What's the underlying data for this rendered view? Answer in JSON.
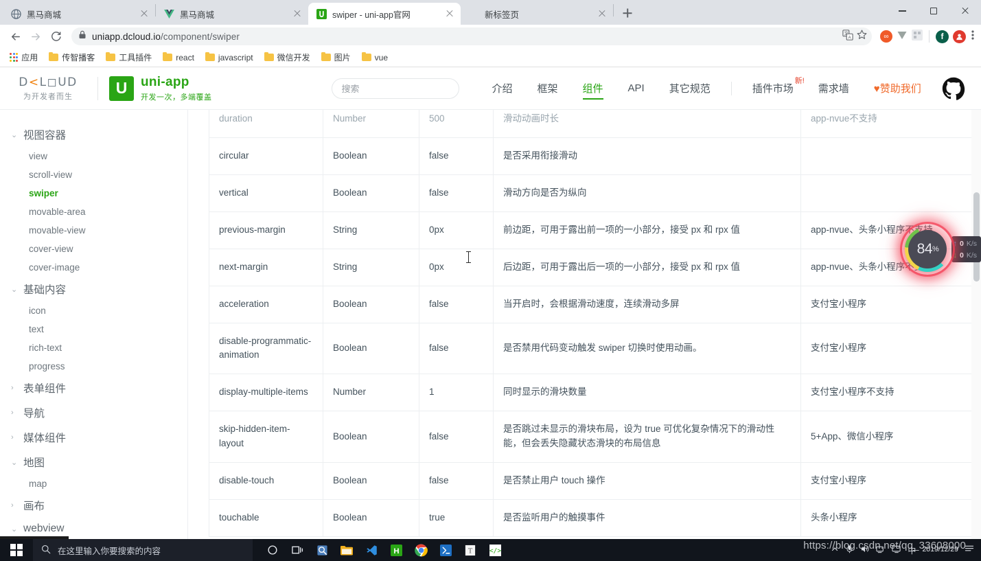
{
  "browser": {
    "tabs": [
      {
        "title": "黑马商城",
        "favicon": "globe-icon",
        "active": false
      },
      {
        "title": "黑马商城",
        "favicon": "vue-icon",
        "active": false
      },
      {
        "title": "swiper - uni-app官网",
        "favicon": "uniapp-icon",
        "active": true
      },
      {
        "title": "新标签页",
        "favicon": "none",
        "active": false
      }
    ],
    "new_tab_label": "+",
    "window_controls": {
      "minimize": "–",
      "maximize": "□",
      "close": "✕"
    },
    "address": {
      "scheme_lock": "lock-icon",
      "host": "uniapp.dcloud.io",
      "path": "/component/swiper"
    },
    "toolbar_icons": [
      "translate-icon",
      "bookmark-star-icon",
      "extension-infinity-icon",
      "extension-v-icon",
      "extension-qr-icon",
      "profile-f-icon",
      "profile-avatar-icon",
      "menu-icon"
    ],
    "bookmarks": [
      {
        "label": "应用",
        "icon": "apps-grid-icon"
      },
      {
        "label": "传智播客",
        "icon": "folder-icon"
      },
      {
        "label": "工具插件",
        "icon": "folder-icon"
      },
      {
        "label": "react",
        "icon": "folder-icon"
      },
      {
        "label": "javascript",
        "icon": "folder-icon"
      },
      {
        "label": "微信开发",
        "icon": "folder-icon"
      },
      {
        "label": "图片",
        "icon": "folder-icon"
      },
      {
        "label": "vue",
        "icon": "folder-icon"
      }
    ]
  },
  "site": {
    "dcloud": {
      "mark": "D<LOUD",
      "tagline": "为开发者而生"
    },
    "uniapp": {
      "logo_letter": "U",
      "name": "uni-app",
      "slogan": "开发一次，多端覆盖"
    },
    "search_placeholder": "搜索",
    "nav": [
      {
        "label": "介绍",
        "active": false
      },
      {
        "label": "框架",
        "active": false
      },
      {
        "label": "组件",
        "active": true
      },
      {
        "label": "API",
        "active": false
      },
      {
        "label": "其它规范",
        "active": false
      }
    ],
    "nav_right": [
      {
        "label": "插件市场",
        "badge": "新!",
        "active": false
      },
      {
        "label": "需求墙",
        "badge": "",
        "active": false
      },
      {
        "label": "赞助我们",
        "badge": "",
        "heart": "♥",
        "sponsor": true
      }
    ],
    "github_icon": "github-icon"
  },
  "sidebar": {
    "groups": [
      {
        "label": "视图容器",
        "caret": "⌄",
        "expanded": true,
        "items": [
          {
            "label": "view",
            "active": false
          },
          {
            "label": "scroll-view",
            "active": false
          },
          {
            "label": "swiper",
            "active": true
          },
          {
            "label": "movable-area",
            "active": false
          },
          {
            "label": "movable-view",
            "active": false
          },
          {
            "label": "cover-view",
            "active": false
          },
          {
            "label": "cover-image",
            "active": false
          }
        ]
      },
      {
        "label": "基础内容",
        "caret": "⌄",
        "expanded": true,
        "items": [
          {
            "label": "icon",
            "active": false
          },
          {
            "label": "text",
            "active": false
          },
          {
            "label": "rich-text",
            "active": false
          },
          {
            "label": "progress",
            "active": false
          }
        ]
      },
      {
        "label": "表单组件",
        "caret": "›",
        "expanded": false,
        "items": []
      },
      {
        "label": "导航",
        "caret": "›",
        "expanded": false,
        "items": []
      },
      {
        "label": "媒体组件",
        "caret": "›",
        "expanded": false,
        "items": []
      },
      {
        "label": "地图",
        "caret": "⌄",
        "expanded": true,
        "items": [
          {
            "label": "map",
            "active": false
          }
        ]
      },
      {
        "label": "画布",
        "caret": "›",
        "expanded": false,
        "items": []
      },
      {
        "label": "webview",
        "caret": "⌄",
        "expanded": true,
        "items": []
      }
    ]
  },
  "table": {
    "rows": [
      {
        "name": "duration",
        "type": "Number",
        "default": "500",
        "desc": "滑动动画时长",
        "platform": "app-nvue不支持",
        "clipped": true
      },
      {
        "name": "circular",
        "type": "Boolean",
        "default": "false",
        "desc": "是否采用衔接滑动",
        "platform": ""
      },
      {
        "name": "vertical",
        "type": "Boolean",
        "default": "false",
        "desc": "滑动方向是否为纵向",
        "platform": ""
      },
      {
        "name": "previous-margin",
        "type": "String",
        "default": "0px",
        "desc": "前边距，可用于露出前一项的一小部分，接受 px 和 rpx 值",
        "platform": "app-nvue、头条小程序不支持"
      },
      {
        "name": "next-margin",
        "type": "String",
        "default": "0px",
        "desc": "后边距，可用于露出后一项的一小部分，接受 px 和 rpx 值",
        "platform": "app-nvue、头条小程序不支持"
      },
      {
        "name": "acceleration",
        "type": "Boolean",
        "default": "false",
        "desc": "当开启时，会根据滑动速度，连续滑动多屏",
        "platform": "支付宝小程序"
      },
      {
        "name": "disable-programmatic-animation",
        "type": "Boolean",
        "default": "false",
        "desc": "是否禁用代码变动触发 swiper 切换时使用动画。",
        "platform": "支付宝小程序"
      },
      {
        "name": "display-multiple-items",
        "type": "Number",
        "default": "1",
        "desc": "同时显示的滑块数量",
        "platform": "支付宝小程序不支持"
      },
      {
        "name": "skip-hidden-item-layout",
        "type": "Boolean",
        "default": "false",
        "desc": "是否跳过未显示的滑块布局，设为 true 可优化复杂情况下的滑动性能，但会丢失隐藏状态滑块的布局信息",
        "platform": "5+App、微信小程序"
      },
      {
        "name": "disable-touch",
        "type": "Boolean",
        "default": "false",
        "desc": "是否禁止用户 touch 操作",
        "platform": "支付宝小程序"
      },
      {
        "name": "touchable",
        "type": "Boolean",
        "default": "true",
        "desc": "是否监听用户的触摸事件",
        "platform": "头条小程序"
      }
    ]
  },
  "netwidget": {
    "percent": "84",
    "percent_unit": "%",
    "upload": {
      "arrow": "↑",
      "value": "0",
      "unit": "K/s"
    },
    "download": {
      "arrow": "↓",
      "value": "0",
      "unit": "K/s"
    }
  },
  "taskbar": {
    "start_icon": "windows-logo-icon",
    "search_placeholder": "在这里输入你要搜索的内容",
    "search_icon": "search-icon",
    "pinned": [
      {
        "icon": "cortana-icon",
        "name": "cortana"
      },
      {
        "icon": "task-view-icon",
        "name": "task-view"
      },
      {
        "icon": "screen-capture-icon",
        "name": "screenshot-tool"
      },
      {
        "icon": "file-explorer-icon",
        "name": "file-explorer"
      },
      {
        "icon": "vscode-icon",
        "name": "visual-studio-code"
      },
      {
        "icon": "hbuilder-icon",
        "name": "hbuilderx"
      },
      {
        "icon": "chrome-icon",
        "name": "google-chrome"
      },
      {
        "icon": "powershell-icon",
        "name": "powershell"
      },
      {
        "icon": "typora-icon",
        "name": "typora"
      },
      {
        "icon": "code-brackets-icon",
        "name": "code-editor"
      }
    ],
    "tray": [
      "chevron-up-icon",
      "microphone-icon",
      "volume-icon",
      "network-icon",
      "display-icon",
      "ime-cn-icon"
    ],
    "clock": {
      "time": "",
      "date": "2019/12/29"
    },
    "notification_icon": "notification-icon"
  },
  "watermark": "https://blog.csdn.net/qq_33608000"
}
